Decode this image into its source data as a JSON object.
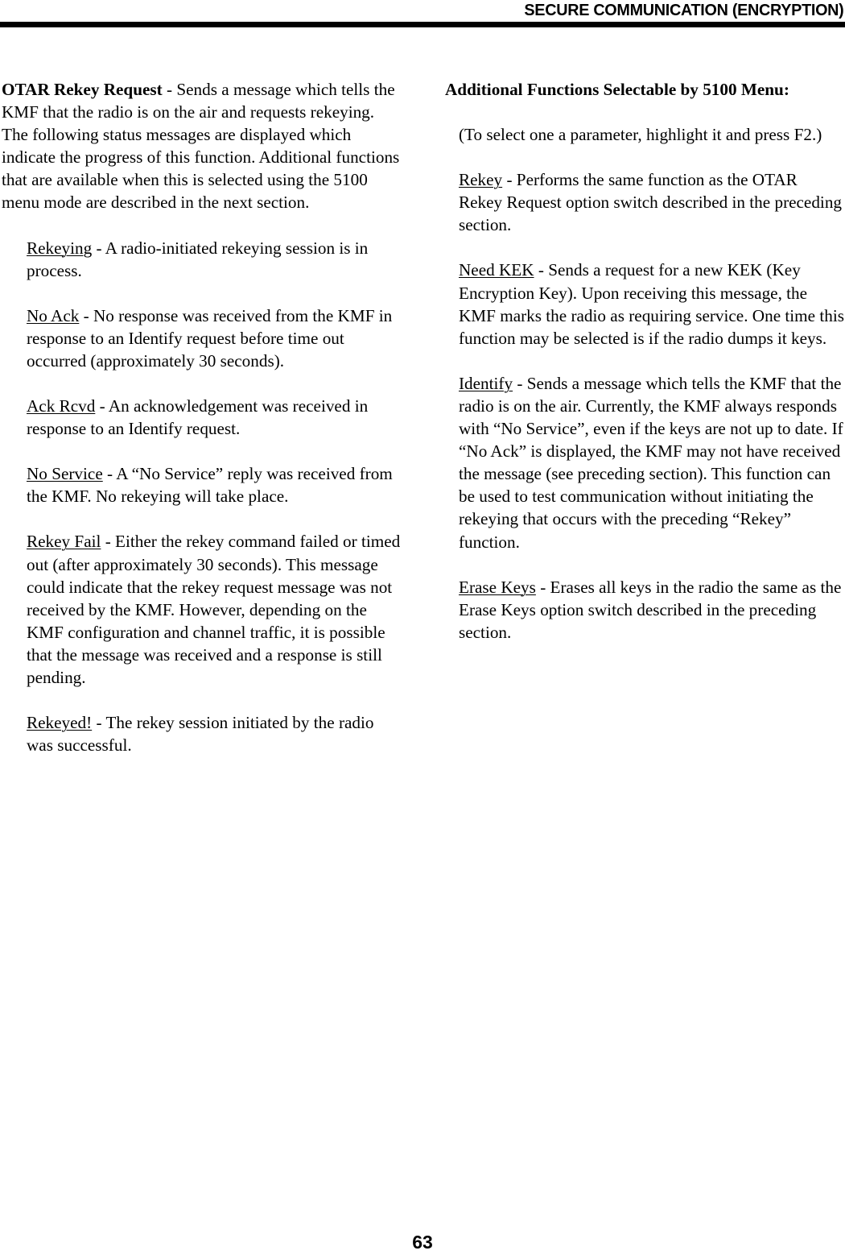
{
  "header": {
    "title": "SECURE COMMUNICATION (ENCRYPTION)"
  },
  "footer": {
    "page_number": "63"
  },
  "left_column": {
    "lead": {
      "term": "OTAR Rekey Request",
      "body": " - Sends a message which tells the KMF that the radio is on the air and requests rekeying. The following status messages are displayed which indicate the progress of this function. Additional functions that are available when this is selected using the 5100 menu mode are described in the next section."
    },
    "items": [
      {
        "term": "Rekeying",
        "body": " - A radio-initiated rekeying session is in process."
      },
      {
        "term": "No Ack",
        "body": " - No response was received from the KMF in response to an Identify request before time out occurred (approximately 30 seconds)."
      },
      {
        "term": "Ack Rcvd",
        "body": " - An acknowledgement was received in response to an Identify request."
      },
      {
        "term": "No Service",
        "body": " - A “No Service” reply was received from the KMF. No rekeying will take place."
      },
      {
        "term": "Rekey Fail",
        "body": " - Either the rekey command failed or timed out (after approximately 30 seconds). This message could indicate that the rekey request message was not received by the KMF. However, depending on the KMF configuration and channel traffic, it is possible that the message was received and a response is still pending."
      },
      {
        "term": "Rekeyed!",
        "body": " - The rekey session initiated by the radio was successful."
      }
    ]
  },
  "right_column": {
    "heading": "Additional Functions Selectable by 5100 Menu:",
    "note": "(To select one a parameter, highlight it and press F2.)",
    "items": [
      {
        "term": "Rekey",
        "body": " - Performs the same function as the OTAR Rekey Request option switch described in the preceding section."
      },
      {
        "term": "Need KEK",
        "body": " - Sends a request for a new KEK (Key Encryption Key). Upon receiving this message, the KMF marks the radio as requiring service. One time this function may be selected is if the radio dumps it keys."
      },
      {
        "term": "Identify",
        "body": " - Sends a message which tells the KMF that the radio is on the air. Currently, the KMF always responds with “No Service”, even if the keys are not up to date. If “No Ack” is displayed, the KMF may not have received the message (see preceding section). This function can be used to test communication without initiating the rekeying that occurs with the preceding “Rekey” function."
      },
      {
        "term": "Erase Keys",
        "body": " - Erases all keys in the radio the same as the Erase Keys option switch described in the preceding section."
      }
    ]
  }
}
